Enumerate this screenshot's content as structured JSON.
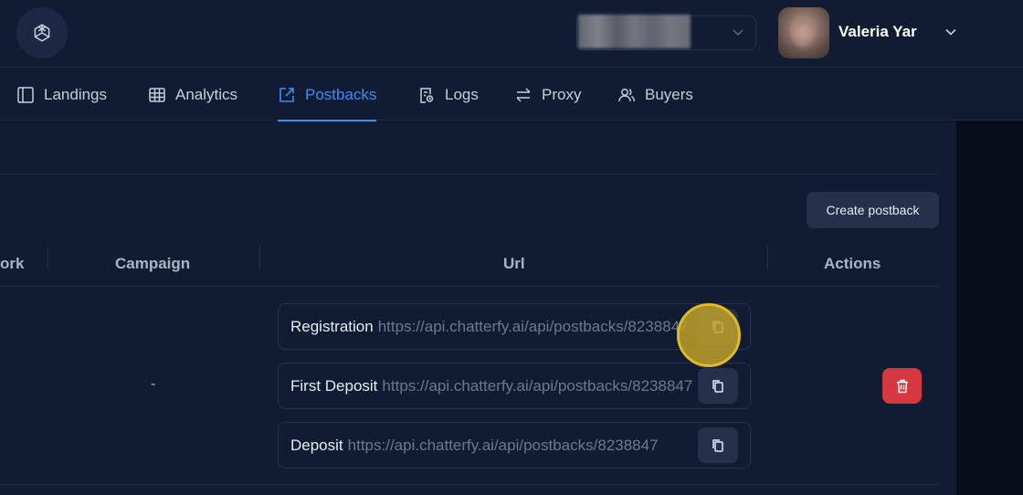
{
  "header": {
    "user_name": "Valeria Yar"
  },
  "nav": {
    "tabs": [
      {
        "label": "Landings",
        "icon": "layout-icon",
        "active": false
      },
      {
        "label": "Analytics",
        "icon": "table-icon",
        "active": false
      },
      {
        "label": "Postbacks",
        "icon": "external-link-icon",
        "active": true
      },
      {
        "label": "Logs",
        "icon": "log-file-icon",
        "active": false
      },
      {
        "label": "Proxy",
        "icon": "arrows-swap-icon",
        "active": false
      },
      {
        "label": "Buyers",
        "icon": "users-icon",
        "active": false
      }
    ]
  },
  "toolbar": {
    "create_label": "Create postback"
  },
  "table": {
    "columns": [
      "ork",
      "Campaign",
      "Url",
      "Actions"
    ],
    "rows": [
      {
        "campaign": "-",
        "urls": [
          {
            "label": "Registration",
            "value": "https://api.chatterfy.ai/api/postbacks/8238847"
          },
          {
            "label": "First Deposit",
            "value": "https://api.chatterfy.ai/api/postbacks/8238847"
          },
          {
            "label": "Deposit",
            "value": "https://api.chatterfy.ai/api/postbacks/8238847"
          }
        ]
      }
    ]
  },
  "colors": {
    "accent": "#3f8cf2",
    "background": "#111c33",
    "danger": "#d5393f",
    "click_marker": "#e0b92a"
  }
}
